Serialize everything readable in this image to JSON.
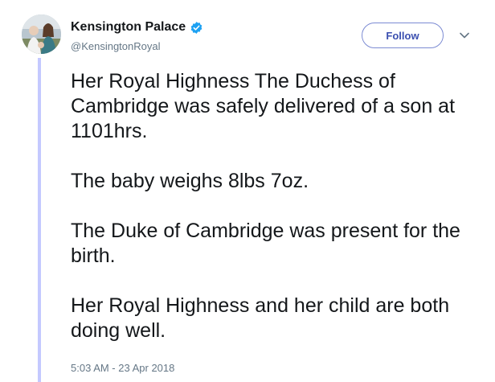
{
  "tweet": {
    "author": {
      "display_name": "Kensington Palace",
      "handle": "@KensingtonRoyal",
      "verified": true,
      "avatar_icon": "profile-photo"
    },
    "follow_label": "Follow",
    "menu_icon": "chevron-down",
    "paragraphs": [
      "Her Royal Highness The Duchess of Cambridge was safely delivered of a son at 1101hrs.",
      "The baby weighs 8lbs 7oz.",
      "The Duke of Cambridge was present for the birth.",
      "Her Royal Highness and her child are both doing well."
    ],
    "timestamp": "5:03 AM - 23 Apr 2018"
  },
  "colors": {
    "text": "#14171a",
    "secondary_text": "#657786",
    "verified_badge": "#1da1f2",
    "follow_border": "#7c8bd3",
    "thread_line": "#c4c9ff"
  }
}
